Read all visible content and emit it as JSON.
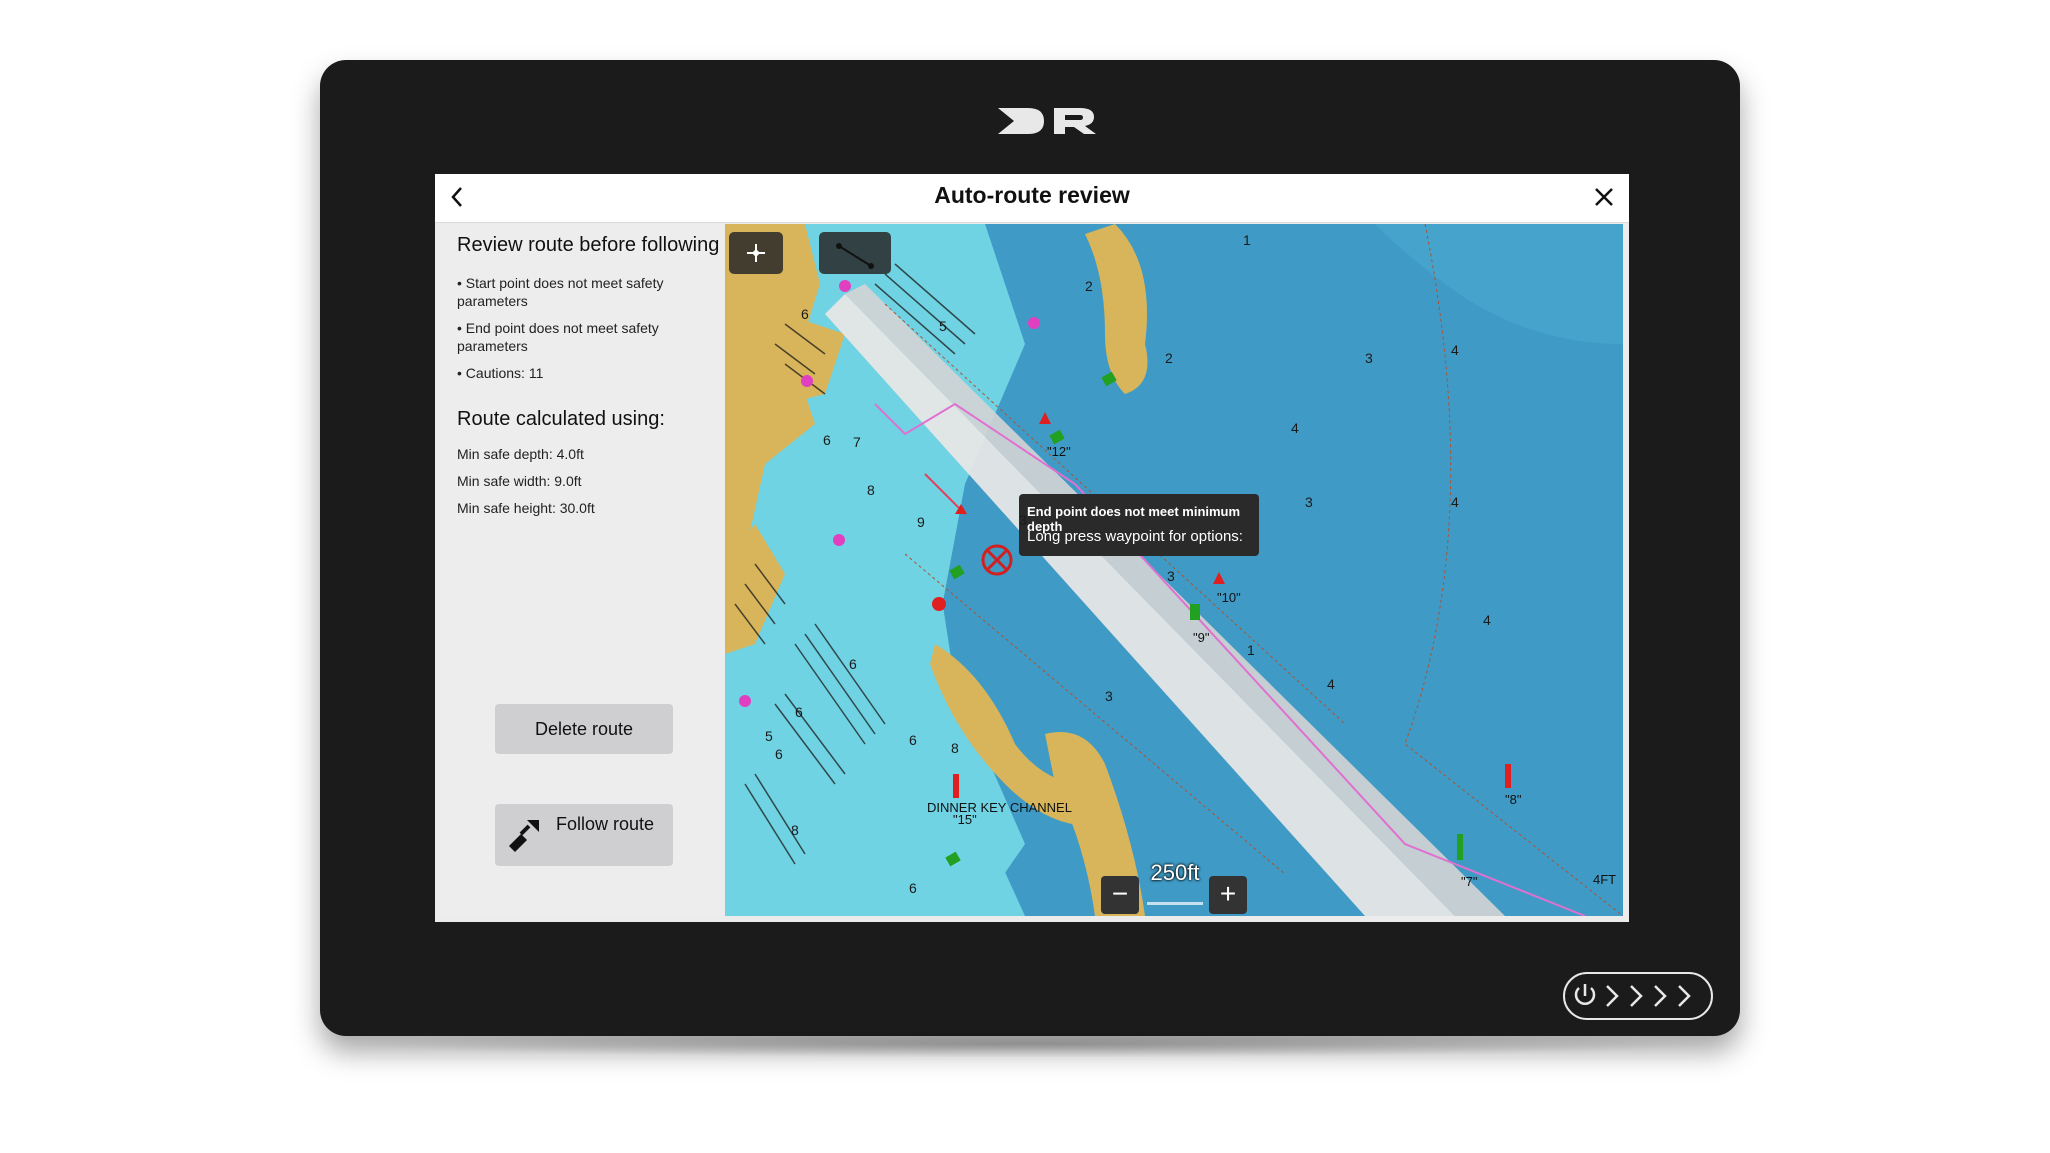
{
  "window": {
    "title": "Auto-route review"
  },
  "sidebar": {
    "heading": "Review route before following",
    "bullets": [
      "• Start point does not meet safety parameters",
      "• End point does not meet safety parameters",
      "• Cautions: 11"
    ],
    "calc_heading": "Route calculated using:",
    "params": [
      "Min safe depth: 4.0ft",
      "Min safe width: 9.0ft",
      "Min safe height: 30.0ft"
    ],
    "delete_label": "Delete route",
    "follow_label": "Follow route"
  },
  "map": {
    "tooltip_title": "End point does not meet minimum depth",
    "tooltip_text": "Long press waypoint for options:",
    "scale": "250ft",
    "zoom_out": "−",
    "zoom_in": "+",
    "channel_label": "DINNER KEY CHANNEL",
    "markers": [
      "\"12\"",
      "\"10\"",
      "\"9\"",
      "\"8\"",
      "\"7\"",
      "\"15\""
    ],
    "corner_label": "4FT",
    "depths": [
      "1",
      "2",
      "2",
      "3",
      "4",
      "4",
      "3",
      "4",
      "3",
      "3",
      "1",
      "4",
      "3",
      "4",
      "8",
      "9",
      "7",
      "5",
      "6",
      "6",
      "6",
      "8",
      "6",
      "5",
      "6",
      "6",
      "8",
      "6"
    ]
  },
  "colors": {
    "land": "#d8b55a",
    "shallow": "#6fd3e3",
    "deep": "#3f9bc6",
    "channel": "#e6e6e6",
    "route": "#e070d0",
    "bezel": "#1b1b1b"
  }
}
